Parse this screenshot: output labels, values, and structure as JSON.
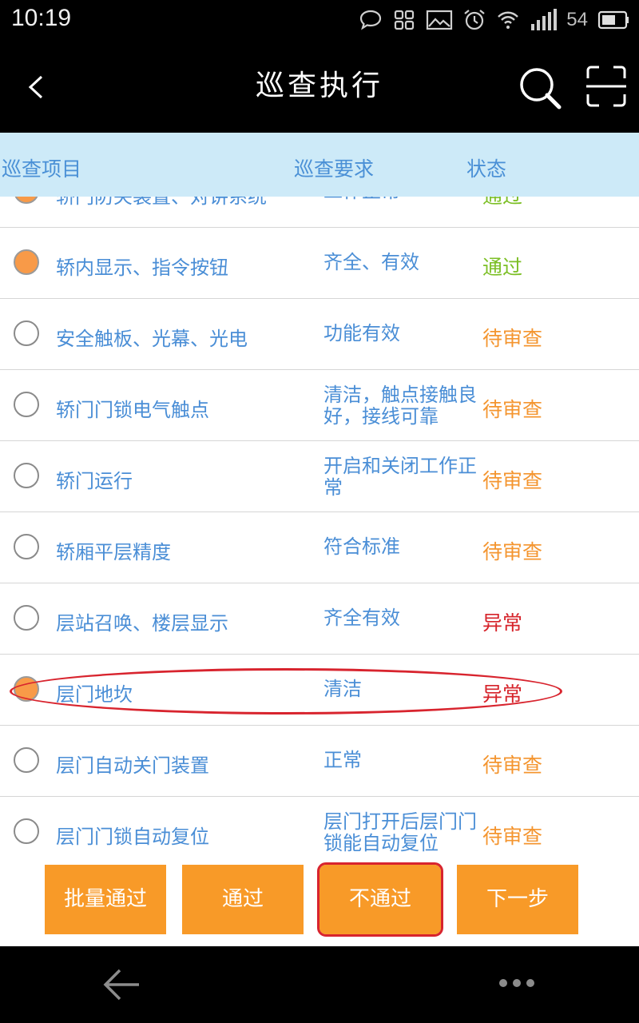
{
  "status_bar": {
    "time": "10:19",
    "battery": "54",
    "icons": [
      "chat-icon",
      "qr-app-icon",
      "image-icon",
      "alarm-icon",
      "wifi-icon",
      "signal-icon",
      "battery-icon"
    ]
  },
  "header": {
    "title": "巡查执行",
    "back_icon": "chevron-left-icon",
    "search_icon": "search-icon",
    "scan_icon": "scan-icon"
  },
  "columns": {
    "item": "巡查项目",
    "requirement": "巡查要求",
    "status": "状态"
  },
  "rows": [
    {
      "item": "轿门防夹装置、对讲系统",
      "requirement": "工作正常",
      "status": "通过",
      "checked": true
    },
    {
      "item": "轿内显示、指令按钮",
      "requirement": "齐全、有效",
      "status": "通过",
      "checked": true
    },
    {
      "item": "安全触板、光幕、光电",
      "requirement": "功能有效",
      "status": "待审查",
      "checked": false
    },
    {
      "item": "轿门门锁电气触点",
      "requirement": "清洁，触点接触良好，接线可靠",
      "status": "待审查",
      "checked": false
    },
    {
      "item": "轿门运行",
      "requirement": "开启和关闭工作正常",
      "status": "待审查",
      "checked": false
    },
    {
      "item": "轿厢平层精度",
      "requirement": "符合标准",
      "status": "待审查",
      "checked": false
    },
    {
      "item": "层站召唤、楼层显示",
      "requirement": "齐全有效",
      "status": "异常",
      "checked": false
    },
    {
      "item": "层门地坎",
      "requirement": "清洁",
      "status": "异常",
      "checked": true
    },
    {
      "item": "层门自动关门装置",
      "requirement": "正常",
      "status": "待审查",
      "checked": false
    },
    {
      "item": "层门门锁自动复位",
      "requirement": "层门打开后层门门锁能自动复位",
      "status": "待审查",
      "checked": false
    }
  ],
  "buttons": {
    "batch_pass": "批量通过",
    "pass": "通过",
    "fail": "不通过",
    "next": "下一步"
  },
  "colors": {
    "accent": "#f89a28",
    "header_bg": "#cdeaf8",
    "text_blue": "#4a8ed6",
    "status_pass": "#7cbf25",
    "status_pending": "#f4952f",
    "status_abnormal": "#d6232a",
    "annotation_red": "#d8242e"
  }
}
